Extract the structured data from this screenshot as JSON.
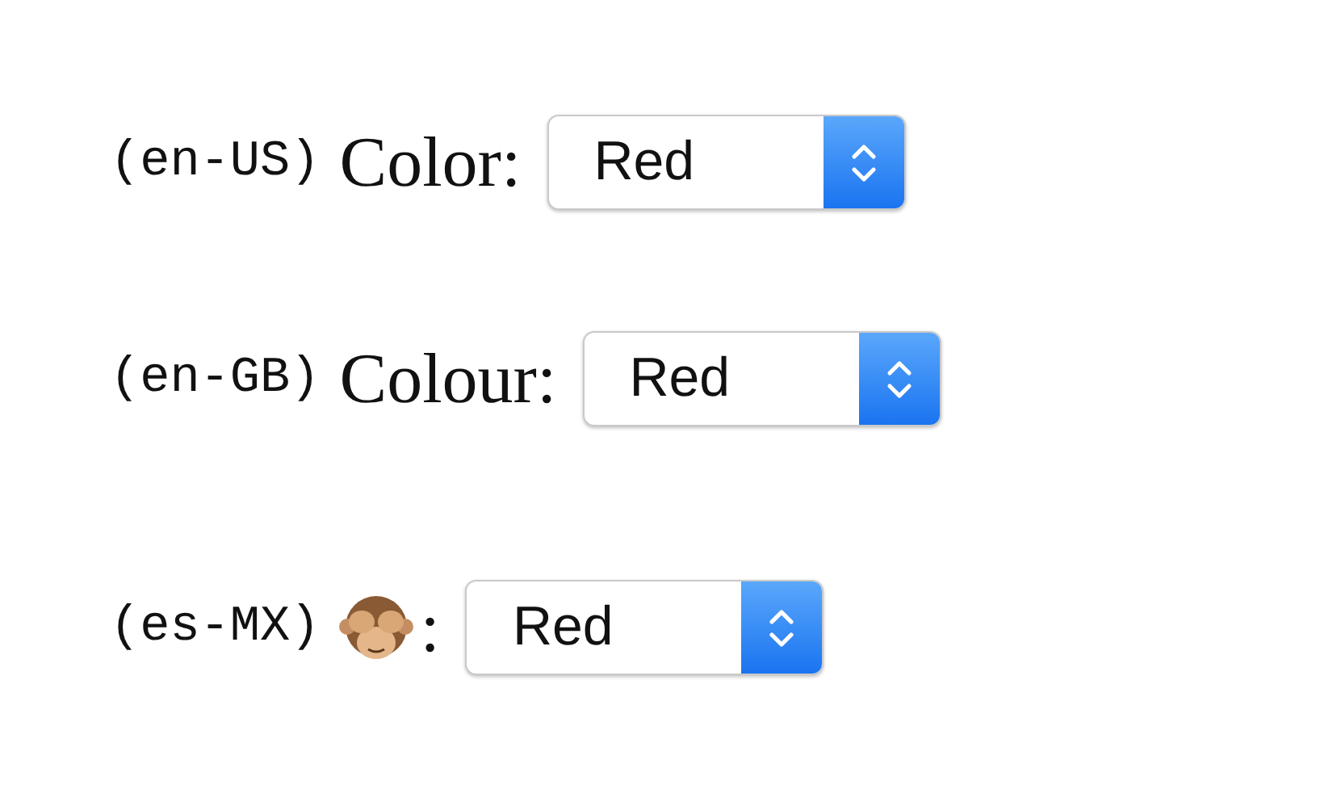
{
  "rows": [
    {
      "kind": "text",
      "locale": "(en-US)",
      "label": "Color:",
      "value": "Red"
    },
    {
      "kind": "text",
      "locale": "(en-GB)",
      "label": "Colour:",
      "value": "Red"
    },
    {
      "kind": "icon",
      "locale": "(es-MX)",
      "label": ":",
      "value": "Red"
    }
  ]
}
